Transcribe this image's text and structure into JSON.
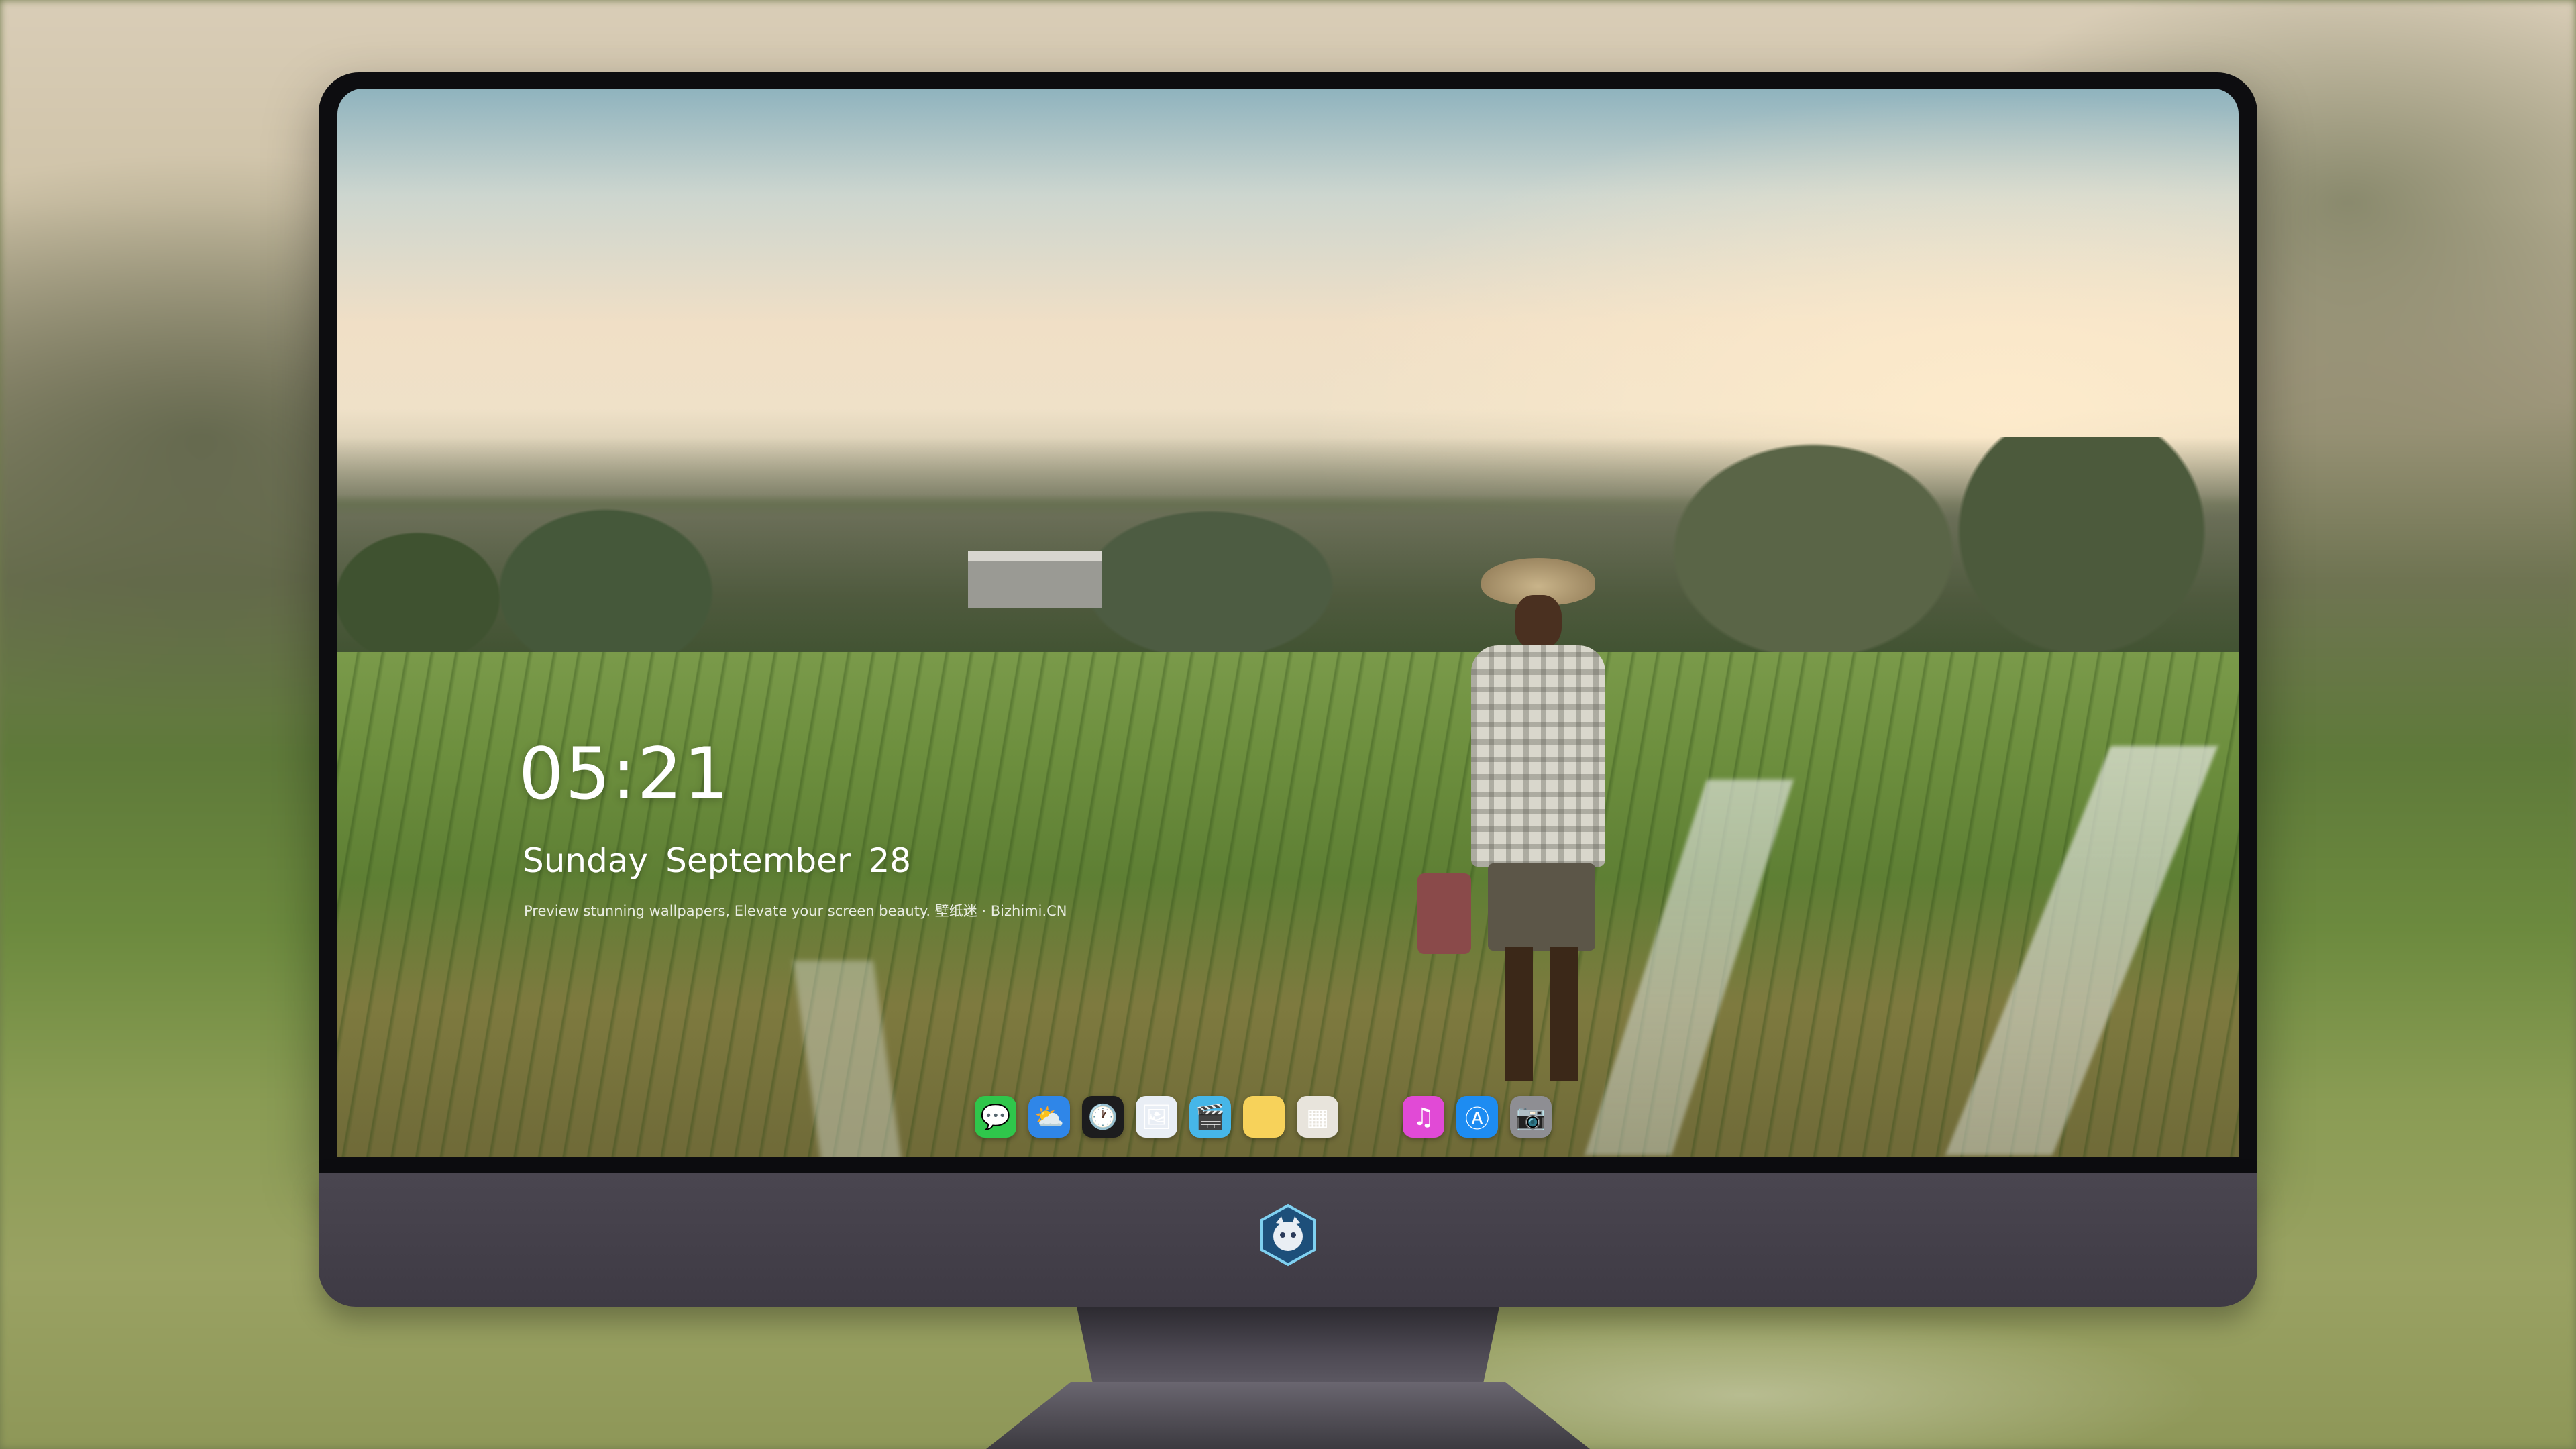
{
  "lock_screen": {
    "time": "05:21",
    "weekday": "Sunday",
    "month": "September",
    "day": "28",
    "caption": "Preview stunning wallpapers, Elevate your screen beauty. 壁纸迷 · Bizhimi.CN"
  },
  "dock": {
    "apps": [
      {
        "name": "messages",
        "icon": "message-bubble-icon",
        "glyph": "💬",
        "color": "#2fc64b"
      },
      {
        "name": "weather",
        "icon": "cloud-sun-icon",
        "glyph": "⛅",
        "color": "#2f86e8"
      },
      {
        "name": "clock",
        "icon": "clock-icon",
        "glyph": "🕐",
        "color": "#1c1c1e"
      },
      {
        "name": "preview",
        "icon": "preview-icon",
        "glyph": "🖼",
        "color": "#e9eef5"
      },
      {
        "name": "clips",
        "icon": "clapperboard-icon",
        "glyph": "🎬",
        "color": "#46b6e8"
      },
      {
        "name": "notes",
        "icon": "notes-icon",
        "glyph": "",
        "color": "#f7d25a"
      },
      {
        "name": "photo-booth",
        "icon": "photo-collage-icon",
        "glyph": "▦",
        "color": "#e8e4dc"
      },
      {
        "name": "music",
        "icon": "music-note-icon",
        "glyph": "♫",
        "color": "#e14ad6"
      },
      {
        "name": "app-store",
        "icon": "app-store-icon",
        "glyph": "Ⓐ",
        "color": "#1d8cf2"
      },
      {
        "name": "camera",
        "icon": "camera-icon",
        "glyph": "📷",
        "color": "#8e8e93"
      }
    ]
  },
  "monitor": {
    "logo": "mascot-logo-icon",
    "bezel_color": "#0d0d10",
    "chin_color": "#443f4a"
  }
}
